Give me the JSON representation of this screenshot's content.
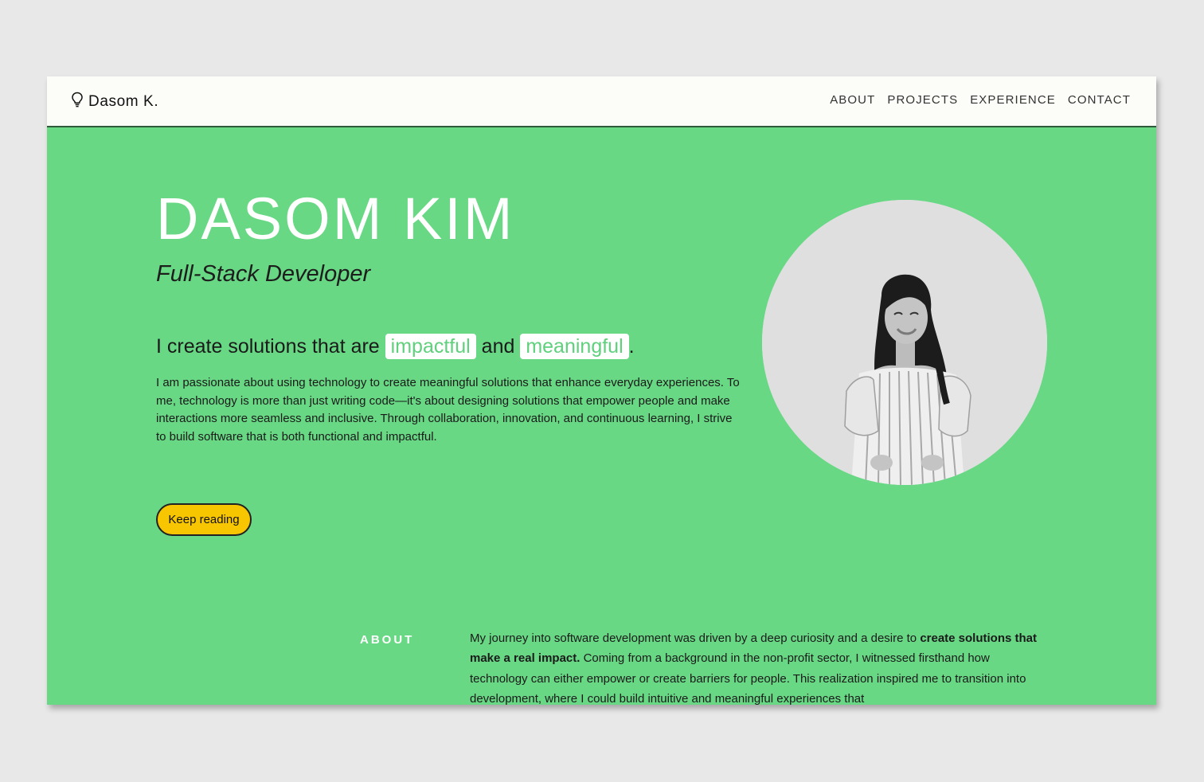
{
  "brand": {
    "name": "Dasom K.",
    "icon": "lightbulb-icon"
  },
  "nav": {
    "items": [
      {
        "label": "ABOUT"
      },
      {
        "label": "PROJECTS"
      },
      {
        "label": "EXPERIENCE"
      },
      {
        "label": "CONTACT"
      }
    ]
  },
  "hero": {
    "name": "DASOM KIM",
    "role": "Full-Stack Developer",
    "tagline_prefix": "I create solutions that are ",
    "tagline_highlight_1": "impactful",
    "tagline_mid": " and ",
    "tagline_highlight_2": "meaningful",
    "tagline_suffix": ".",
    "intro": "I am passionate about using technology to create meaningful solutions that enhance everyday experiences. To me, technology is more than just writing code—it's about designing solutions that empower people and make interactions more seamless and inclusive. Through collaboration, innovation, and continuous learning, I strive to build software that is both functional and impactful.",
    "cta_label": "Keep reading"
  },
  "about": {
    "label": "ABOUT",
    "text_1": "My journey into software development was driven by a deep curiosity and a desire to ",
    "text_bold": "create solutions that make a real impact.",
    "text_2": " Coming from a background in the non-profit sector, I witnessed firsthand how technology can either empower or create barriers for people. This realization inspired me to transition into development, where I could build intuitive and meaningful experiences that"
  },
  "colors": {
    "page_bg": "#e8e8e8",
    "hero_bg": "#68d884",
    "navbar_bg": "#fcfcf8",
    "cta_bg": "#f7c600",
    "highlight_text": "#5fd07c"
  }
}
